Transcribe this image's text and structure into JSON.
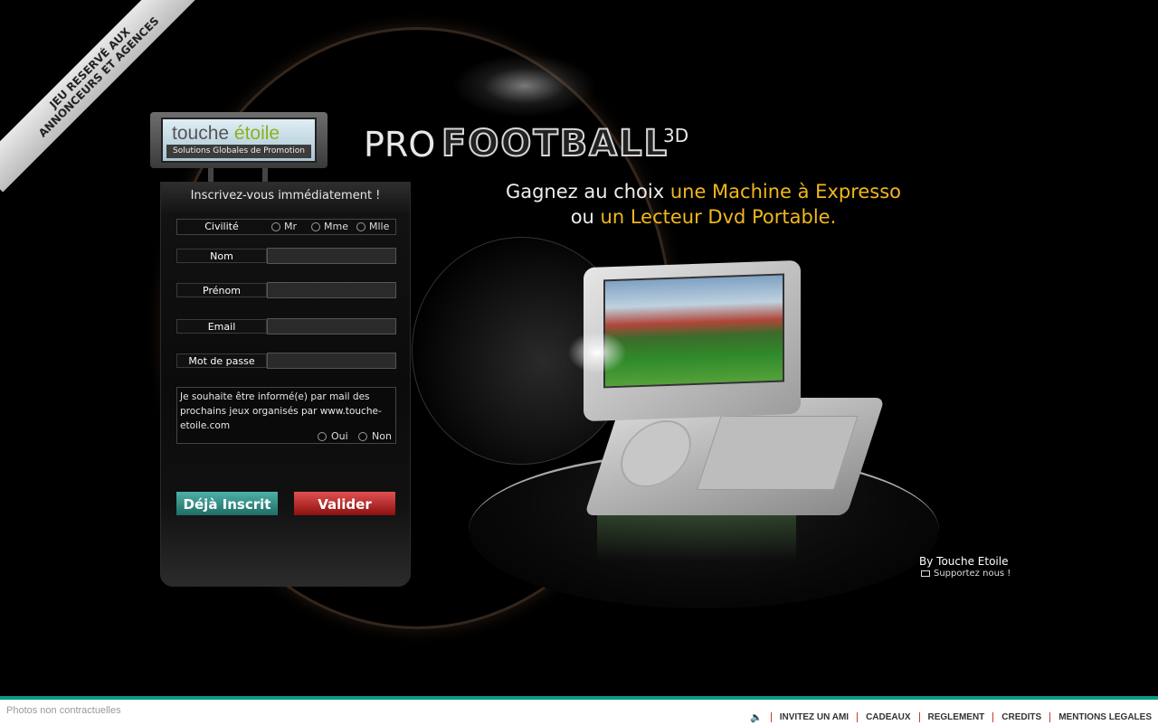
{
  "corner_banner": {
    "line1": "JEU RESERVÉ AUX",
    "line2": "ANNONCEURS ET AGENCES"
  },
  "logo": {
    "word_part1": "touche ",
    "word_part2": "étoile",
    "tagline": "Solutions Globales de Promotion"
  },
  "form": {
    "title": "Inscrivez-vous immédiatement !",
    "civilite_label": "Civilité",
    "civilite_options": [
      "Mr",
      "Mme",
      "Mlle"
    ],
    "fields": [
      {
        "label": "Nom",
        "value": ""
      },
      {
        "label": "Prénom",
        "value": ""
      },
      {
        "label": "Email",
        "value": ""
      },
      {
        "label": "Mot de passe",
        "value": ""
      }
    ],
    "optin_text": "Je souhaite être informé(e) par mail des prochains jeux organisés par www.touche-etoile.com",
    "optin_yes": "Oui",
    "optin_no": "Non",
    "deja_inscrit_label": "Déjà Inscrit",
    "valider_label": "Valider"
  },
  "title": {
    "pro": "PRO",
    "football": "FOOTBALL",
    "suffix": "3D"
  },
  "headline": {
    "part1": "Gagnez au choix ",
    "prize1": "une Machine à Expresso",
    "part2": "ou ",
    "prize2": "un Lecteur Dvd Portable."
  },
  "credits": {
    "by": "By Touche Etoile",
    "support": "Supportez nous !"
  },
  "footer": {
    "note": "Photos non contractuelles",
    "links": [
      "INVITEZ UN AMI",
      "CADEAUX",
      "REGLEMENT",
      "CREDITS",
      "MENTIONS LEGALES"
    ]
  },
  "colors": {
    "accent_yellow": "#f2b71c",
    "footer_green": "#0a9a82",
    "valider_red": "#c42a2a",
    "deja_teal": "#2f8c84"
  },
  "icons": {
    "sound": "speaker-icon",
    "mail": "mail-icon"
  }
}
